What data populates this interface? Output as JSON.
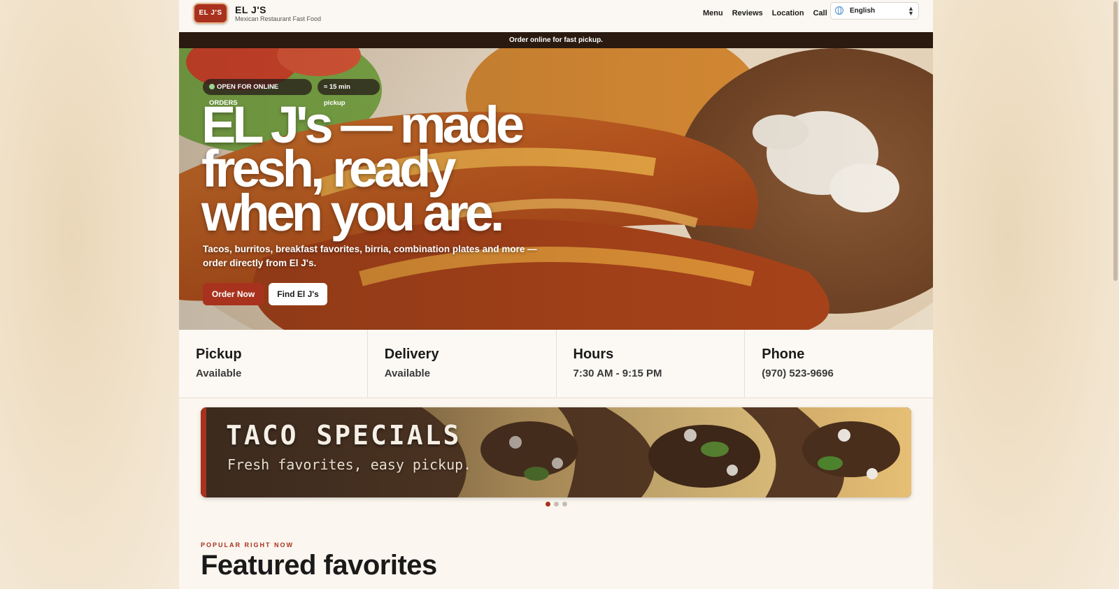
{
  "header": {
    "logo_text": "EL J'S",
    "brand_name": "EL J'S",
    "brand_tagline": "Mexican Restaurant Fast Food",
    "nav": [
      {
        "label": "Menu"
      },
      {
        "label": "Reviews"
      },
      {
        "label": "Location"
      },
      {
        "label": "Call"
      }
    ],
    "language": {
      "selected": "English"
    }
  },
  "promo_bar": {
    "text": "Order online for fast pickup."
  },
  "hero": {
    "status_pill": "OPEN FOR ONLINE ORDERS",
    "pickup_pill": "≈ 15 min pickup",
    "title": "EL J's — made fresh, ready when you are.",
    "subtitle": "Tacos, burritos, breakfast favorites, birria, combination plates and more — order directly from El J's.",
    "primary_button": "Order Now",
    "secondary_button": "Find El J's"
  },
  "info": [
    {
      "title": "Pickup",
      "value": "Available"
    },
    {
      "title": "Delivery",
      "value": "Available"
    },
    {
      "title": "Hours",
      "value": "7:30 AM - 9:15 PM"
    },
    {
      "title": "Phone",
      "value": "(970) 523-9696"
    }
  ],
  "banner": {
    "title": "TACO SPECIALS",
    "subtitle": "Fresh favorites, easy pickup.",
    "slides": 3,
    "active_slide": 1
  },
  "featured": {
    "eyebrow": "POPULAR RIGHT NOW",
    "title": "Featured favorites"
  },
  "colors": {
    "accent": "#a8321d",
    "promo_bar": "#2a1a10",
    "page_bg": "#fbf6ef",
    "backdrop": "#f3e6d2",
    "open_indicator": "#9dd58f"
  },
  "icons": {
    "language": "globe-icon",
    "language_toggle": "updown-chevron-icon"
  }
}
